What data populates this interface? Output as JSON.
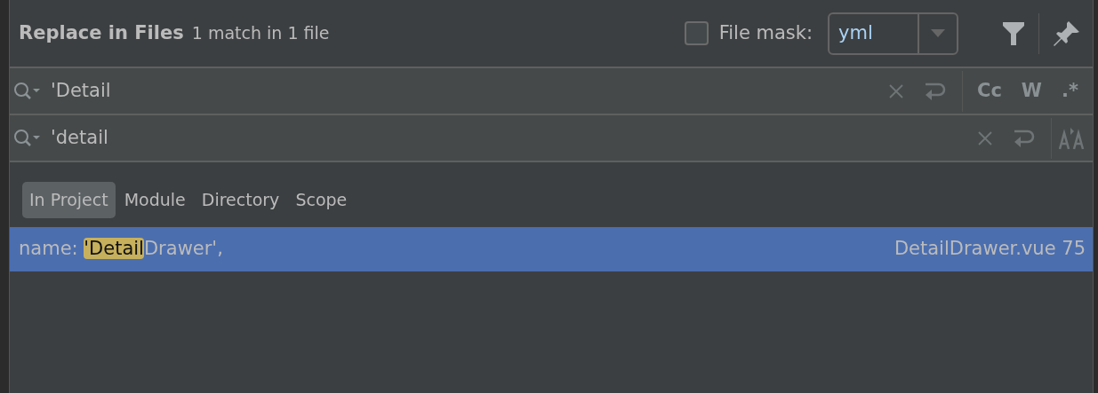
{
  "window": {
    "title": "Replace in Files",
    "summary": "1 match in 1 file"
  },
  "file_mask": {
    "label": "File mask:",
    "checked": false,
    "value": "yml"
  },
  "search": {
    "value": "'Detail",
    "options": [
      {
        "label": "Cc",
        "selected": false
      },
      {
        "label": "W",
        "selected": false
      },
      {
        "label": ".*",
        "selected": false
      }
    ]
  },
  "replace": {
    "value": "'detail"
  },
  "scopes": [
    {
      "label": "In Project",
      "selected": true
    },
    {
      "label": "Module",
      "selected": false
    },
    {
      "label": "Directory",
      "selected": false
    },
    {
      "label": "Scope",
      "selected": false
    }
  ],
  "results": [
    {
      "prefix": "name: ",
      "match": "'Detail",
      "suffix": "Drawer',",
      "file": "DetailDrawer.vue 75",
      "selected": true
    }
  ]
}
